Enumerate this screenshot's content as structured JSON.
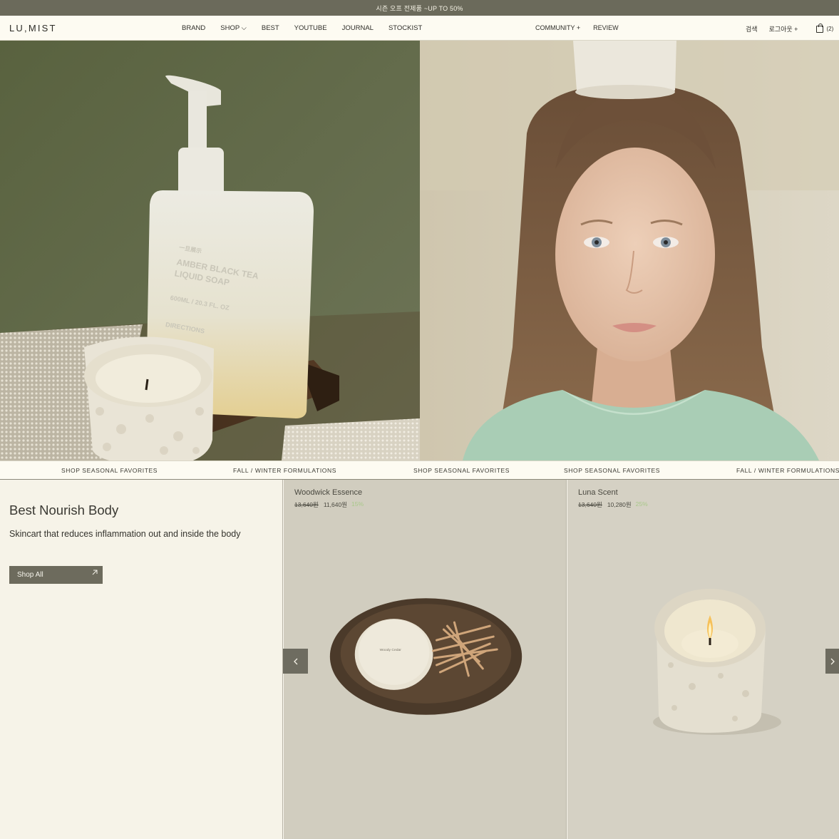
{
  "announcement": "시즌 오프 전제품 ~UP TO 50%",
  "header": {
    "logo": "LU,MIST",
    "nav_main": [
      "BRAND",
      "SHOP ⌵",
      "BEST",
      "YOUTUBE",
      "JOURNAL",
      "STOCKIST"
    ],
    "nav_mid": [
      "COMMUNITY +",
      "REVIEW"
    ],
    "search": "검색",
    "logout": "로그아웃 +",
    "cart_count": "(2)"
  },
  "hero": {
    "bottle_label": [
      "一旦展示",
      "AMBER BLACK TEA",
      "LIQUID SOAP",
      "600ML / 20.3 FL. OZ",
      "DIRECTIONS"
    ]
  },
  "marquee": [
    "SHOP SEASONAL FAVORITES",
    "FALL / WINTER FORMULATIONS",
    "SHOP SEASONAL FAVORITES",
    "SHOP SEASONAL FAVORITES",
    "FALL / WINTER FORMULATIONS"
  ],
  "promo": {
    "title": "Best Nourish Body",
    "subtitle": "Skincart that reduces inflammation out and inside the body",
    "button": "Shop All"
  },
  "products": [
    {
      "name": "Woodwick Essence",
      "old_price": "13,640원",
      "price": "11,640원",
      "discount": "15%",
      "label": "Woody Cedar"
    },
    {
      "name": "Luna Scent",
      "old_price": "13,640원",
      "price": "10,280원",
      "discount": "25%"
    }
  ],
  "icons": {
    "cart": "shopping-bag-icon",
    "arrow": "arrow-up-right-icon",
    "prev": "chevron-left-icon",
    "next": "chevron-right-icon"
  }
}
